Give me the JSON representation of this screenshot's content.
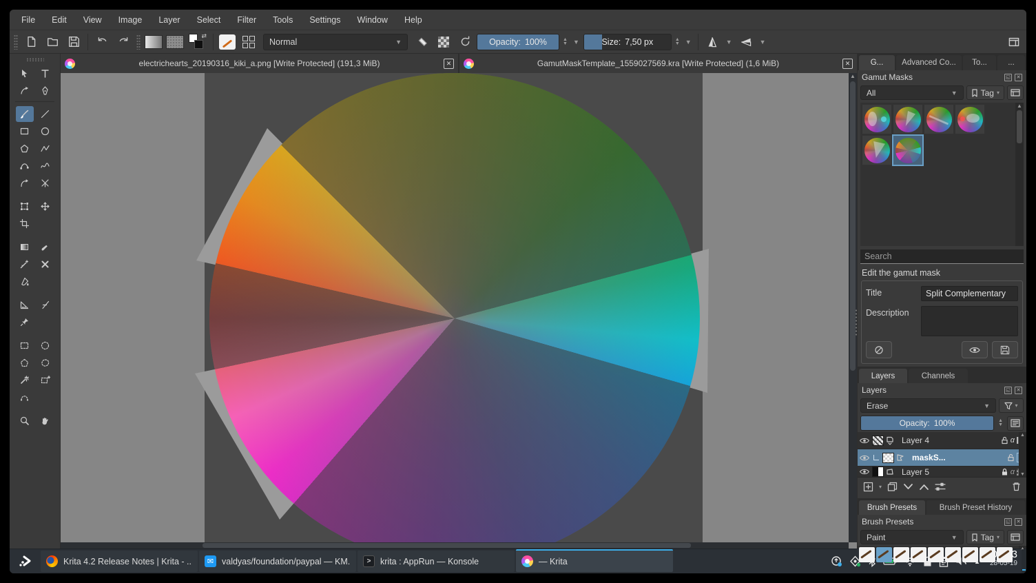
{
  "menu": {
    "items": [
      "File",
      "Edit",
      "View",
      "Image",
      "Layer",
      "Select",
      "Filter",
      "Tools",
      "Settings",
      "Window",
      "Help"
    ]
  },
  "toolbar": {
    "blending_mode": "Normal",
    "opacity_label": "Opacity:",
    "opacity_value": "100%",
    "size_label": "Size:",
    "size_value": "7,50 px"
  },
  "document_tabs": [
    {
      "title": "electrichearts_20190316_kiki_a.png [Write Protected]  (191,3 MiB)"
    },
    {
      "title": "GamutMaskTemplate_1559027569.kra [Write Protected]  (1,6 MiB)"
    }
  ],
  "right_panel": {
    "docker_tabs": [
      "G...",
      "Advanced Co...",
      "To...",
      "..."
    ],
    "gamut_masks": {
      "title": "Gamut Masks",
      "filter_value": "All",
      "tag_label": "Tag",
      "search_placeholder": "Search",
      "edit_label": "Edit the gamut mask",
      "title_label": "Title",
      "title_value": "Split Complementary",
      "description_label": "Description"
    },
    "layers": {
      "tab_layers": "Layers",
      "tab_channels": "Channels",
      "title": "Layers",
      "blending_mode": "Erase",
      "opacity_label": "Opacity:",
      "opacity_value": "100%",
      "rows": [
        {
          "name": "Layer 4"
        },
        {
          "name": "maskS..."
        },
        {
          "name": "Layer 5"
        }
      ]
    },
    "brush_presets": {
      "tab_presets": "Brush Presets",
      "tab_history": "Brush Preset History",
      "title": "Brush Presets",
      "filter_value": "Paint",
      "tag_label": "Tag"
    }
  },
  "taskbar": {
    "tasks": [
      {
        "label": "Krita 4.2 Release Notes | Krita - ..."
      },
      {
        "label": "valdyas/foundation/paypal — KM..."
      },
      {
        "label": "krita : AppRun — Konsole"
      },
      {
        "label": "— Krita"
      }
    ],
    "clock_time": "09:13",
    "clock_date": "28-05-19"
  },
  "colors": {
    "accent": "#3daee9",
    "slider_blue": "#54789b",
    "selection_blue": "#5d83a1",
    "canvas_gray": "#868686",
    "image_gray": "#4a4a4a"
  }
}
